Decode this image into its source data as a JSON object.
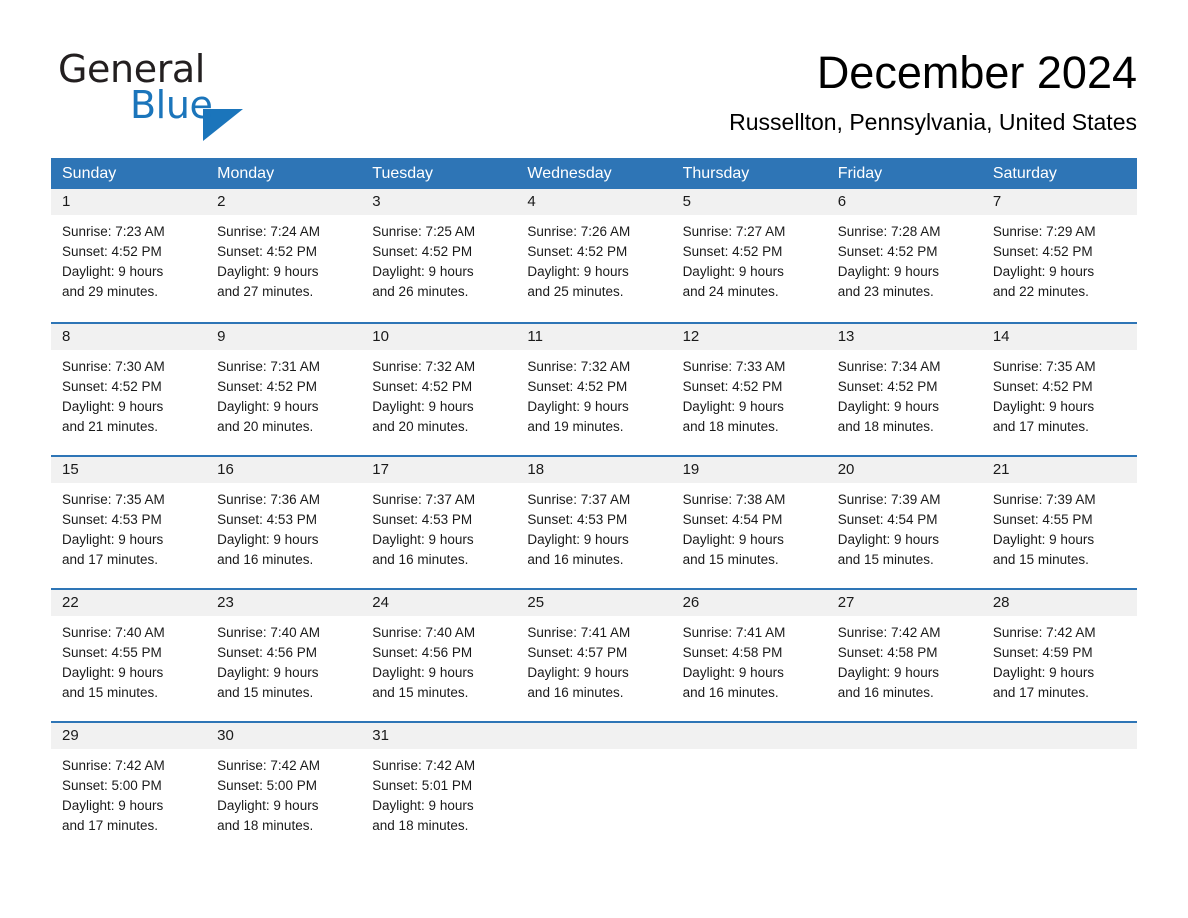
{
  "brand": {
    "name_part1": "General",
    "name_part2": "Blue",
    "triangle_icon": "brand-triangle-icon",
    "accent_color": "#1b75bb"
  },
  "header": {
    "month_title": "December 2024",
    "location": "Russellton, Pennsylvania, United States"
  },
  "theme": {
    "header_bar_color": "#2e75b6",
    "row_border_color": "#2e75b6",
    "day_band_color": "#f1f1f1",
    "text_color": "#1a1a1a"
  },
  "weekdays": [
    "Sunday",
    "Monday",
    "Tuesday",
    "Wednesday",
    "Thursday",
    "Friday",
    "Saturday"
  ],
  "weeks": [
    {
      "days": [
        {
          "date": "1",
          "sunrise": "Sunrise: 7:23 AM",
          "sunset": "Sunset: 4:52 PM",
          "daylight_line1": "Daylight: 9 hours",
          "daylight_line2": "and 29 minutes."
        },
        {
          "date": "2",
          "sunrise": "Sunrise: 7:24 AM",
          "sunset": "Sunset: 4:52 PM",
          "daylight_line1": "Daylight: 9 hours",
          "daylight_line2": "and 27 minutes."
        },
        {
          "date": "3",
          "sunrise": "Sunrise: 7:25 AM",
          "sunset": "Sunset: 4:52 PM",
          "daylight_line1": "Daylight: 9 hours",
          "daylight_line2": "and 26 minutes."
        },
        {
          "date": "4",
          "sunrise": "Sunrise: 7:26 AM",
          "sunset": "Sunset: 4:52 PM",
          "daylight_line1": "Daylight: 9 hours",
          "daylight_line2": "and 25 minutes."
        },
        {
          "date": "5",
          "sunrise": "Sunrise: 7:27 AM",
          "sunset": "Sunset: 4:52 PM",
          "daylight_line1": "Daylight: 9 hours",
          "daylight_line2": "and 24 minutes."
        },
        {
          "date": "6",
          "sunrise": "Sunrise: 7:28 AM",
          "sunset": "Sunset: 4:52 PM",
          "daylight_line1": "Daylight: 9 hours",
          "daylight_line2": "and 23 minutes."
        },
        {
          "date": "7",
          "sunrise": "Sunrise: 7:29 AM",
          "sunset": "Sunset: 4:52 PM",
          "daylight_line1": "Daylight: 9 hours",
          "daylight_line2": "and 22 minutes."
        }
      ]
    },
    {
      "days": [
        {
          "date": "8",
          "sunrise": "Sunrise: 7:30 AM",
          "sunset": "Sunset: 4:52 PM",
          "daylight_line1": "Daylight: 9 hours",
          "daylight_line2": "and 21 minutes."
        },
        {
          "date": "9",
          "sunrise": "Sunrise: 7:31 AM",
          "sunset": "Sunset: 4:52 PM",
          "daylight_line1": "Daylight: 9 hours",
          "daylight_line2": "and 20 minutes."
        },
        {
          "date": "10",
          "sunrise": "Sunrise: 7:32 AM",
          "sunset": "Sunset: 4:52 PM",
          "daylight_line1": "Daylight: 9 hours",
          "daylight_line2": "and 20 minutes."
        },
        {
          "date": "11",
          "sunrise": "Sunrise: 7:32 AM",
          "sunset": "Sunset: 4:52 PM",
          "daylight_line1": "Daylight: 9 hours",
          "daylight_line2": "and 19 minutes."
        },
        {
          "date": "12",
          "sunrise": "Sunrise: 7:33 AM",
          "sunset": "Sunset: 4:52 PM",
          "daylight_line1": "Daylight: 9 hours",
          "daylight_line2": "and 18 minutes."
        },
        {
          "date": "13",
          "sunrise": "Sunrise: 7:34 AM",
          "sunset": "Sunset: 4:52 PM",
          "daylight_line1": "Daylight: 9 hours",
          "daylight_line2": "and 18 minutes."
        },
        {
          "date": "14",
          "sunrise": "Sunrise: 7:35 AM",
          "sunset": "Sunset: 4:52 PM",
          "daylight_line1": "Daylight: 9 hours",
          "daylight_line2": "and 17 minutes."
        }
      ]
    },
    {
      "days": [
        {
          "date": "15",
          "sunrise": "Sunrise: 7:35 AM",
          "sunset": "Sunset: 4:53 PM",
          "daylight_line1": "Daylight: 9 hours",
          "daylight_line2": "and 17 minutes."
        },
        {
          "date": "16",
          "sunrise": "Sunrise: 7:36 AM",
          "sunset": "Sunset: 4:53 PM",
          "daylight_line1": "Daylight: 9 hours",
          "daylight_line2": "and 16 minutes."
        },
        {
          "date": "17",
          "sunrise": "Sunrise: 7:37 AM",
          "sunset": "Sunset: 4:53 PM",
          "daylight_line1": "Daylight: 9 hours",
          "daylight_line2": "and 16 minutes."
        },
        {
          "date": "18",
          "sunrise": "Sunrise: 7:37 AM",
          "sunset": "Sunset: 4:53 PM",
          "daylight_line1": "Daylight: 9 hours",
          "daylight_line2": "and 16 minutes."
        },
        {
          "date": "19",
          "sunrise": "Sunrise: 7:38 AM",
          "sunset": "Sunset: 4:54 PM",
          "daylight_line1": "Daylight: 9 hours",
          "daylight_line2": "and 15 minutes."
        },
        {
          "date": "20",
          "sunrise": "Sunrise: 7:39 AM",
          "sunset": "Sunset: 4:54 PM",
          "daylight_line1": "Daylight: 9 hours",
          "daylight_line2": "and 15 minutes."
        },
        {
          "date": "21",
          "sunrise": "Sunrise: 7:39 AM",
          "sunset": "Sunset: 4:55 PM",
          "daylight_line1": "Daylight: 9 hours",
          "daylight_line2": "and 15 minutes."
        }
      ]
    },
    {
      "days": [
        {
          "date": "22",
          "sunrise": "Sunrise: 7:40 AM",
          "sunset": "Sunset: 4:55 PM",
          "daylight_line1": "Daylight: 9 hours",
          "daylight_line2": "and 15 minutes."
        },
        {
          "date": "23",
          "sunrise": "Sunrise: 7:40 AM",
          "sunset": "Sunset: 4:56 PM",
          "daylight_line1": "Daylight: 9 hours",
          "daylight_line2": "and 15 minutes."
        },
        {
          "date": "24",
          "sunrise": "Sunrise: 7:40 AM",
          "sunset": "Sunset: 4:56 PM",
          "daylight_line1": "Daylight: 9 hours",
          "daylight_line2": "and 15 minutes."
        },
        {
          "date": "25",
          "sunrise": "Sunrise: 7:41 AM",
          "sunset": "Sunset: 4:57 PM",
          "daylight_line1": "Daylight: 9 hours",
          "daylight_line2": "and 16 minutes."
        },
        {
          "date": "26",
          "sunrise": "Sunrise: 7:41 AM",
          "sunset": "Sunset: 4:58 PM",
          "daylight_line1": "Daylight: 9 hours",
          "daylight_line2": "and 16 minutes."
        },
        {
          "date": "27",
          "sunrise": "Sunrise: 7:42 AM",
          "sunset": "Sunset: 4:58 PM",
          "daylight_line1": "Daylight: 9 hours",
          "daylight_line2": "and 16 minutes."
        },
        {
          "date": "28",
          "sunrise": "Sunrise: 7:42 AM",
          "sunset": "Sunset: 4:59 PM",
          "daylight_line1": "Daylight: 9 hours",
          "daylight_line2": "and 17 minutes."
        }
      ]
    },
    {
      "days": [
        {
          "date": "29",
          "sunrise": "Sunrise: 7:42 AM",
          "sunset": "Sunset: 5:00 PM",
          "daylight_line1": "Daylight: 9 hours",
          "daylight_line2": "and 17 minutes."
        },
        {
          "date": "30",
          "sunrise": "Sunrise: 7:42 AM",
          "sunset": "Sunset: 5:00 PM",
          "daylight_line1": "Daylight: 9 hours",
          "daylight_line2": "and 18 minutes."
        },
        {
          "date": "31",
          "sunrise": "Sunrise: 7:42 AM",
          "sunset": "Sunset: 5:01 PM",
          "daylight_line1": "Daylight: 9 hours",
          "daylight_line2": "and 18 minutes."
        },
        {
          "date": "",
          "sunrise": "",
          "sunset": "",
          "daylight_line1": "",
          "daylight_line2": ""
        },
        {
          "date": "",
          "sunrise": "",
          "sunset": "",
          "daylight_line1": "",
          "daylight_line2": ""
        },
        {
          "date": "",
          "sunrise": "",
          "sunset": "",
          "daylight_line1": "",
          "daylight_line2": ""
        },
        {
          "date": "",
          "sunrise": "",
          "sunset": "",
          "daylight_line1": "",
          "daylight_line2": ""
        }
      ]
    }
  ]
}
